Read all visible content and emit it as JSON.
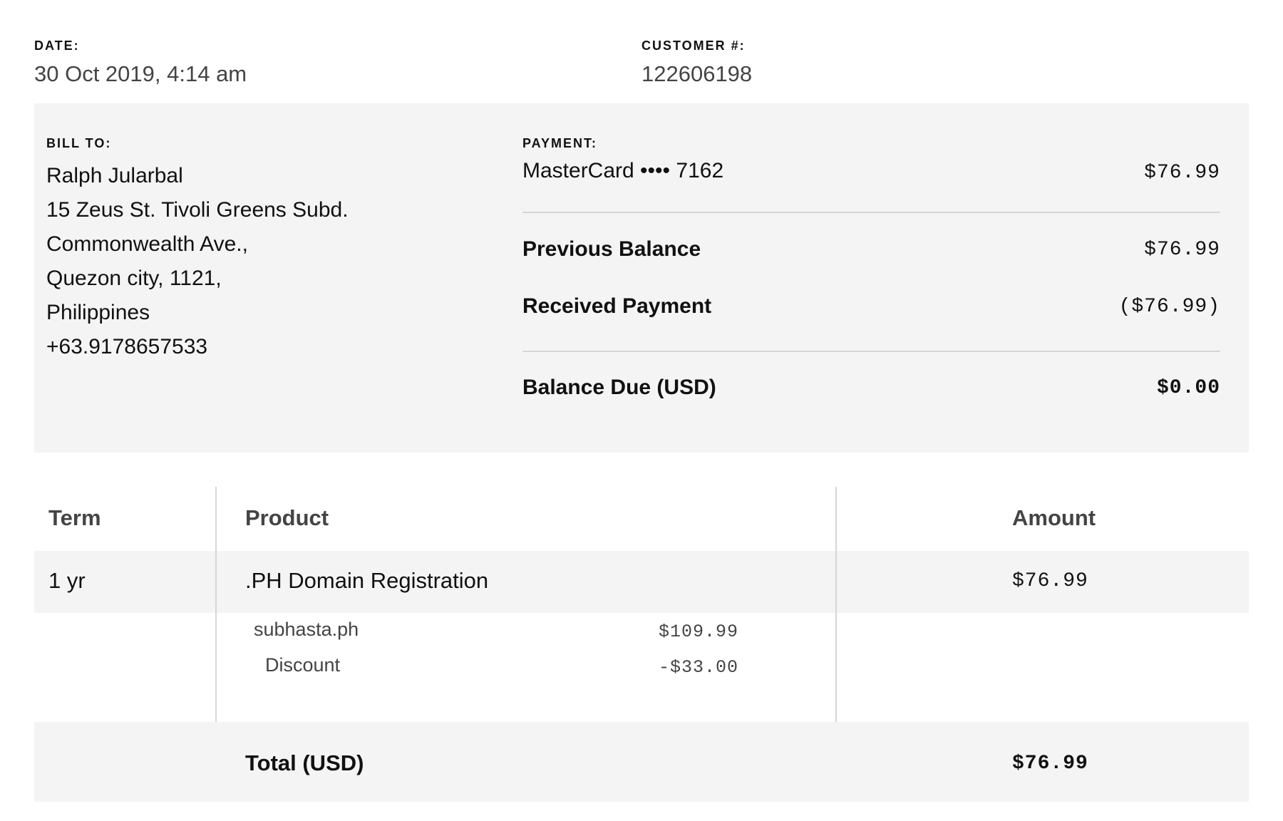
{
  "header": {
    "date_label": "DATE:",
    "date_value": "30 Oct 2019, 4:14 am",
    "customer_label": "CUSTOMER #:",
    "customer_value": "122606198"
  },
  "bill_to": {
    "label": "BILL TO:",
    "lines": [
      "Ralph Jularbal",
      "15 Zeus St. Tivoli Greens Subd.",
      "Commonwealth Ave.,",
      "Quezon city, 1121,",
      "Philippines",
      "+63.9178657533"
    ]
  },
  "payment": {
    "label": "PAYMENT:",
    "method": "MasterCard •••• 7162",
    "amount": "$76.99",
    "previous_balance_label": "Previous Balance",
    "previous_balance_value": "$76.99",
    "received_payment_label": "Received Payment",
    "received_payment_value": "($76.99)",
    "balance_due_label": "Balance Due (USD)",
    "balance_due_value": "$0.00"
  },
  "items": {
    "headers": {
      "term": "Term",
      "product": "Product",
      "amount": "Amount"
    },
    "rows": [
      {
        "term": "1 yr",
        "product": ".PH Domain Registration",
        "amount": "$76.99",
        "details": [
          {
            "label": "subhasta.ph",
            "value": "$109.99"
          },
          {
            "label": "Discount",
            "value": "-$33.00"
          }
        ]
      }
    ],
    "total_label": "Total (USD)",
    "total_value": "$76.99"
  }
}
